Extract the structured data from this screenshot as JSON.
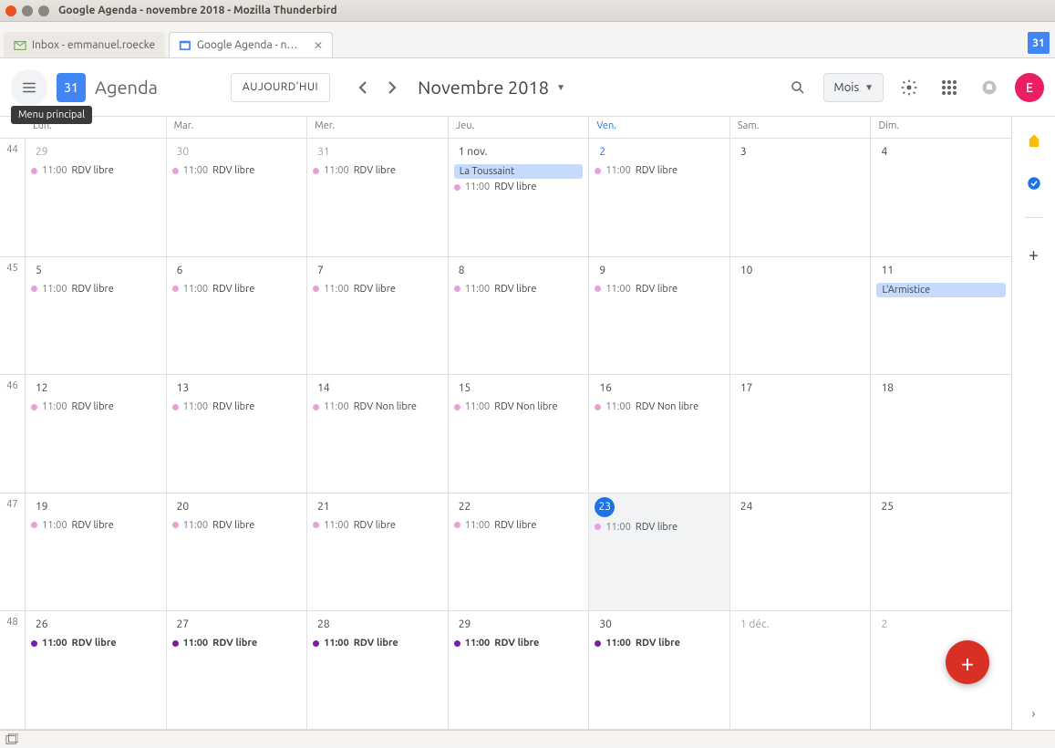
{
  "window": {
    "title": "Google Agenda - novembre 2018 - Mozilla Thunderbird"
  },
  "tabs": {
    "inbox": "Inbox - emmanuel.roecke",
    "calendar": "Google Agenda - nove"
  },
  "header": {
    "tooltip": "Menu principal",
    "logo_text": "31",
    "app_title": "Agenda",
    "today_btn": "AUJOURD'HUI",
    "month_label": "Novembre 2018",
    "view_select": "Mois",
    "avatar_initial": "E"
  },
  "corner_icon": "31",
  "dayheads": [
    "Lun.",
    "Mar.",
    "Mer.",
    "Jeu.",
    "Ven.",
    "Sam.",
    "Dim."
  ],
  "weeknums": [
    "44",
    "45",
    "46",
    "47",
    "48"
  ],
  "weeks": [
    [
      {
        "n": "29",
        "other": true,
        "evts": [
          {
            "t": "11:00",
            "l": "RDV libre",
            "d": "pink"
          }
        ]
      },
      {
        "n": "30",
        "other": true,
        "evts": [
          {
            "t": "11:00",
            "l": "RDV libre",
            "d": "pink"
          }
        ]
      },
      {
        "n": "31",
        "other": true,
        "evts": [
          {
            "t": "11:00",
            "l": "RDV libre",
            "d": "pink"
          }
        ]
      },
      {
        "n": "1 nov.",
        "allday": "La Toussaint",
        "evts": [
          {
            "t": "11:00",
            "l": "RDV libre",
            "d": "pink"
          }
        ]
      },
      {
        "n": "2",
        "hl": true,
        "evts": [
          {
            "t": "11:00",
            "l": "RDV libre",
            "d": "pink"
          }
        ]
      },
      {
        "n": "3"
      },
      {
        "n": "4"
      }
    ],
    [
      {
        "n": "5",
        "evts": [
          {
            "t": "11:00",
            "l": "RDV libre",
            "d": "pink"
          }
        ]
      },
      {
        "n": "6",
        "evts": [
          {
            "t": "11:00",
            "l": "RDV libre",
            "d": "pink"
          }
        ]
      },
      {
        "n": "7",
        "evts": [
          {
            "t": "11:00",
            "l": "RDV libre",
            "d": "pink"
          }
        ]
      },
      {
        "n": "8",
        "evts": [
          {
            "t": "11:00",
            "l": "RDV libre",
            "d": "pink"
          }
        ]
      },
      {
        "n": "9",
        "evts": [
          {
            "t": "11:00",
            "l": "RDV libre",
            "d": "pink"
          }
        ]
      },
      {
        "n": "10"
      },
      {
        "n": "11",
        "allday": "L'Armistice"
      }
    ],
    [
      {
        "n": "12",
        "evts": [
          {
            "t": "11:00",
            "l": "RDV libre",
            "d": "pink"
          }
        ]
      },
      {
        "n": "13",
        "evts": [
          {
            "t": "11:00",
            "l": "RDV libre",
            "d": "pink"
          }
        ]
      },
      {
        "n": "14",
        "evts": [
          {
            "t": "11:00",
            "l": "RDV Non libre",
            "d": "pink"
          }
        ]
      },
      {
        "n": "15",
        "evts": [
          {
            "t": "11:00",
            "l": "RDV Non libre",
            "d": "pink"
          }
        ]
      },
      {
        "n": "16",
        "evts": [
          {
            "t": "11:00",
            "l": "RDV Non libre",
            "d": "pink"
          }
        ]
      },
      {
        "n": "17"
      },
      {
        "n": "18"
      }
    ],
    [
      {
        "n": "19",
        "evts": [
          {
            "t": "11:00",
            "l": "RDV libre",
            "d": "pink"
          }
        ]
      },
      {
        "n": "20",
        "evts": [
          {
            "t": "11:00",
            "l": "RDV libre",
            "d": "pink"
          }
        ]
      },
      {
        "n": "21",
        "evts": [
          {
            "t": "11:00",
            "l": "RDV libre",
            "d": "pink"
          }
        ]
      },
      {
        "n": "22",
        "evts": [
          {
            "t": "11:00",
            "l": "RDV libre",
            "d": "pink"
          }
        ]
      },
      {
        "n": "23",
        "circled": true,
        "selected": true,
        "evts": [
          {
            "t": "11:00",
            "l": "RDV libre",
            "d": "pink"
          }
        ]
      },
      {
        "n": "24"
      },
      {
        "n": "25"
      }
    ],
    [
      {
        "n": "26",
        "evts": [
          {
            "t": "11:00",
            "l": "RDV libre",
            "d": "purple",
            "b": true
          }
        ]
      },
      {
        "n": "27",
        "evts": [
          {
            "t": "11:00",
            "l": "RDV libre",
            "d": "purple",
            "b": true
          }
        ]
      },
      {
        "n": "28",
        "evts": [
          {
            "t": "11:00",
            "l": "RDV libre",
            "d": "purple",
            "b": true
          }
        ]
      },
      {
        "n": "29",
        "evts": [
          {
            "t": "11:00",
            "l": "RDV libre",
            "d": "purple",
            "b": true
          }
        ]
      },
      {
        "n": "30",
        "evts": [
          {
            "t": "11:00",
            "l": "RDV libre",
            "d": "purple",
            "b": true
          }
        ]
      },
      {
        "n": "1 déc.",
        "other": true
      },
      {
        "n": "2",
        "other": true
      }
    ]
  ]
}
